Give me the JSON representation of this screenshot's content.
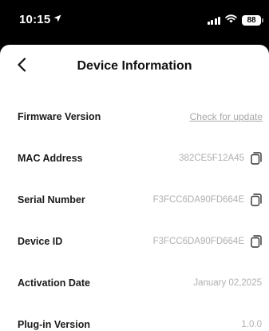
{
  "status_bar": {
    "time": "10:15",
    "location_icon": "location-arrow-icon",
    "battery_level": "88"
  },
  "header": {
    "back_icon": "chevron-left-icon",
    "title": "Device Information"
  },
  "rows": [
    {
      "label": "Firmware Version",
      "link": "Check for update"
    },
    {
      "label": "MAC Address",
      "value": "382CE5F12A45",
      "copy_icon": "copy-icon"
    },
    {
      "label": "Serial Number",
      "value": "F3FCC6DA90FD664E",
      "copy_icon": "copy-icon"
    },
    {
      "label": "Device ID",
      "value": "F3FCC6DA90FD664E",
      "copy_icon": "copy-icon"
    },
    {
      "label": "Activation Date",
      "value": "January 02,2025"
    },
    {
      "label": "Plug-in Version",
      "value": "1.0.0"
    }
  ],
  "colors": {
    "label": "#1a1a1a",
    "value": "#b0b0b0",
    "background": "#ffffff",
    "status_bar": "#000000"
  }
}
